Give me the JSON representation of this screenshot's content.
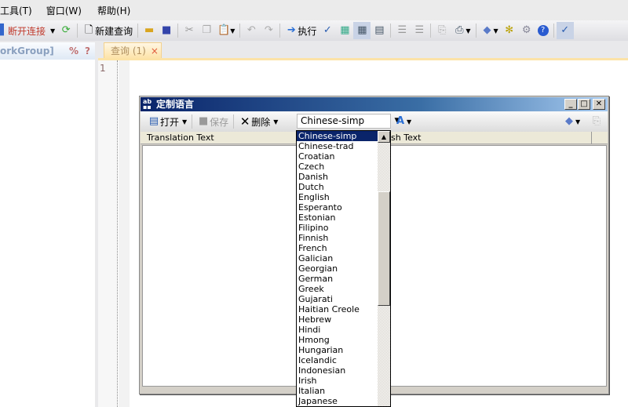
{
  "menu": [
    "工具(T)",
    "窗口(W)",
    "帮助(H)"
  ],
  "toolbar": {
    "disconnect": "断开连接",
    "new_query": "新建查询",
    "execute": "执行"
  },
  "left_panel": {
    "title": "orkGroup]",
    "percent": "%",
    "help": "?"
  },
  "tab": {
    "label": "查询 (1)",
    "close": "×"
  },
  "editor": {
    "line_numbers": [
      "1"
    ]
  },
  "dialog": {
    "title": "定制语言",
    "open": "打开",
    "save": "保存",
    "delete": "删除",
    "language_selected": "Chinese-simp",
    "columns": [
      "Translation Text",
      "English Text"
    ],
    "language_options": [
      "Chinese-simp",
      "Chinese-trad",
      "Croatian",
      "Czech",
      "Danish",
      "Dutch",
      "English",
      "Esperanto",
      "Estonian",
      "Filipino",
      "Finnish",
      "French",
      "Galician",
      "Georgian",
      "German",
      "Greek",
      "Gujarati",
      "Haitian Creole",
      "Hebrew",
      "Hindi",
      "Hmong",
      "Hungarian",
      "Icelandic",
      "Indonesian",
      "Irish",
      "Italian",
      "Japanese"
    ]
  },
  "colors": {
    "title_bar": "#0a246a",
    "selection": "#0a246a",
    "tab": "#fde3a7",
    "disconnect_text": "#c0392b"
  }
}
